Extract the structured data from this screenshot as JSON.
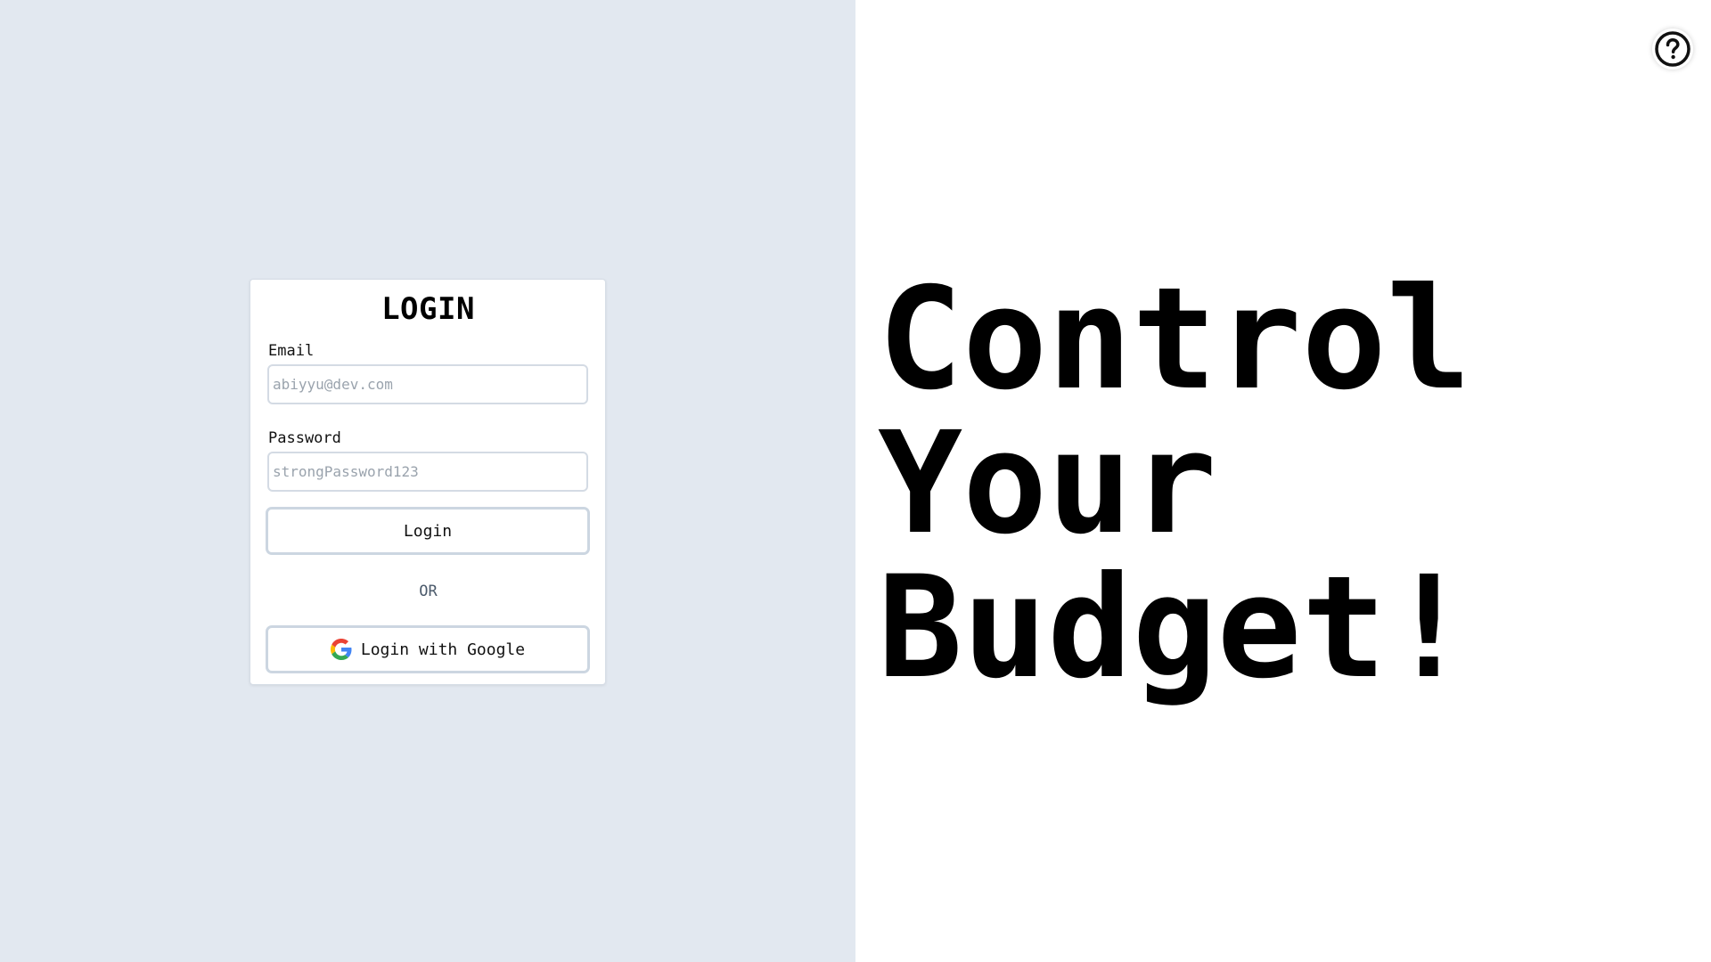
{
  "login": {
    "title": "LOGIN",
    "email_label": "Email",
    "email_placeholder": "abiyyu@dev.com",
    "password_label": "Password",
    "password_placeholder": "strongPassword123",
    "login_button": "Login",
    "separator": "OR",
    "google_button": "Login with Google"
  },
  "hero": {
    "line1": "Control",
    "line2": "Your",
    "line3": "Budget!"
  },
  "icons": {
    "help": "question-circle-icon",
    "google": "google-logo-icon"
  },
  "colors": {
    "left_background": "#e2e8f0",
    "right_background": "#ffffff",
    "input_border": "#d4dbe4",
    "button_border": "#ccd6e1"
  }
}
